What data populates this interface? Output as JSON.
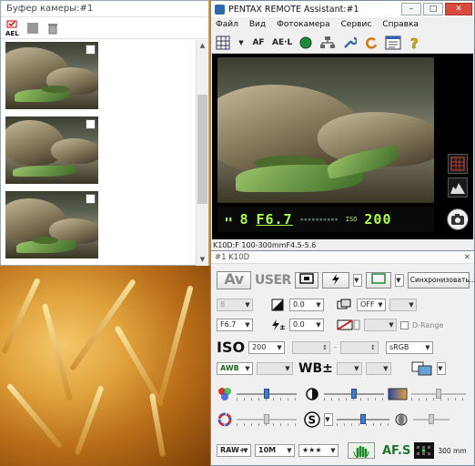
{
  "buffer": {
    "title": "Буфер камеры:#1",
    "toolbar": [
      "ael-select-icon",
      "stop-icon",
      "trash-icon"
    ],
    "toolbar_label": "AEL"
  },
  "pentax": {
    "title": "PENTAX REMOTE Assistant:#1",
    "window_buttons": {
      "minimize": "–",
      "maximize": "□",
      "close": "✕"
    },
    "menu": [
      "Файл",
      "Вид",
      "Фотокамера",
      "Сервис",
      "Справка"
    ],
    "toolbar": {
      "af": "AF",
      "ael": "AE·L"
    },
    "lcd": {
      "shots": "8",
      "aperture": "F6.7",
      "iso_label": "ISO",
      "iso_value": "200"
    },
    "status": "K10D:F 100-300mmF4.5-5.6"
  },
  "panel": {
    "title": "#1 K10D",
    "close": "✕",
    "mode": "Av",
    "user": "USER",
    "sync_button": "Синхронизовать...",
    "shutter": "8",
    "aperture": "F6.7",
    "exposure_comp": "0.0",
    "flash_comp": "0.0",
    "bracket": "OFF",
    "drange_label": "D-Range",
    "iso_title": "ISO",
    "iso_value": "200",
    "color_space": "sRGB",
    "wb": "AWB",
    "wb_title": "WB±",
    "raw_format": "RAW+",
    "resolution": "10M",
    "quality": "★★★",
    "af_label": "AF.S",
    "focal_length": "300 mm"
  }
}
